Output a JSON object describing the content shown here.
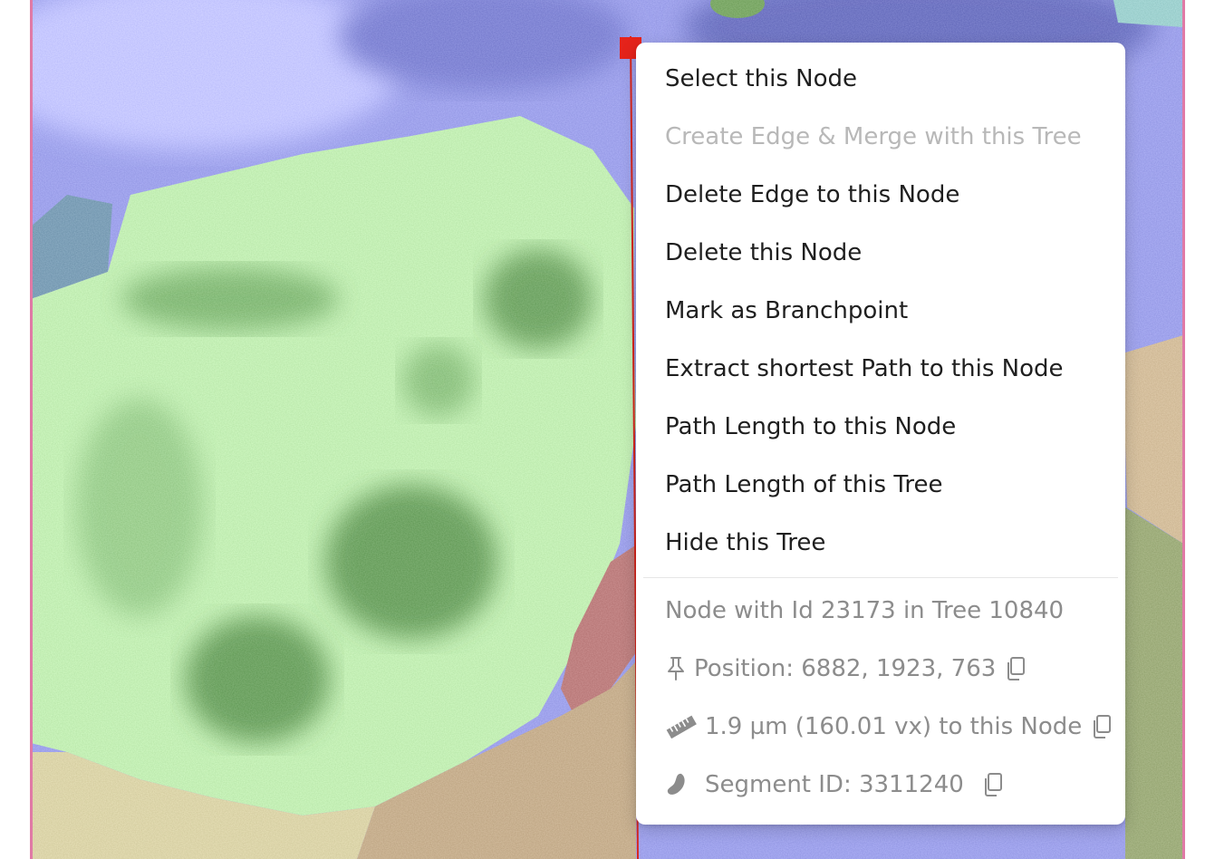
{
  "context_menu": {
    "items": [
      {
        "label": "Select this Node",
        "enabled": true
      },
      {
        "label": "Create Edge & Merge with this Tree",
        "enabled": false
      },
      {
        "label": "Delete Edge to this Node",
        "enabled": true
      },
      {
        "label": "Delete this Node",
        "enabled": true
      },
      {
        "label": "Mark as Branchpoint",
        "enabled": true
      },
      {
        "label": "Extract shortest Path to this Node",
        "enabled": true
      },
      {
        "label": "Path Length to this Node",
        "enabled": true
      },
      {
        "label": "Path Length of this Tree",
        "enabled": true
      },
      {
        "label": "Hide this Tree",
        "enabled": true
      }
    ],
    "info": {
      "node_summary": "Node with Id 23173 in Tree 10840",
      "position": "Position: 6882, 1923, 763",
      "distance": "1.9 µm (160.01 vx) to this Node",
      "segment": "Segment ID: 3311240"
    },
    "icons": {
      "position": "pushpin-icon",
      "distance": "ruler-icon",
      "segment": "segment-blob-icon",
      "copy": "copy-icon"
    }
  },
  "colors": {
    "frame_border": "#e07aa6",
    "skeleton_node": "#e5231b",
    "skeleton_edge": "#d9261c",
    "segment_blue": "#8f93e0",
    "segment_green": "#b5e3a6",
    "segment_tan": "#b9a07e",
    "segment_red": "#b06e6e",
    "segment_yellow": "#cfc79a",
    "segment_teal": "#6b8fa8"
  }
}
